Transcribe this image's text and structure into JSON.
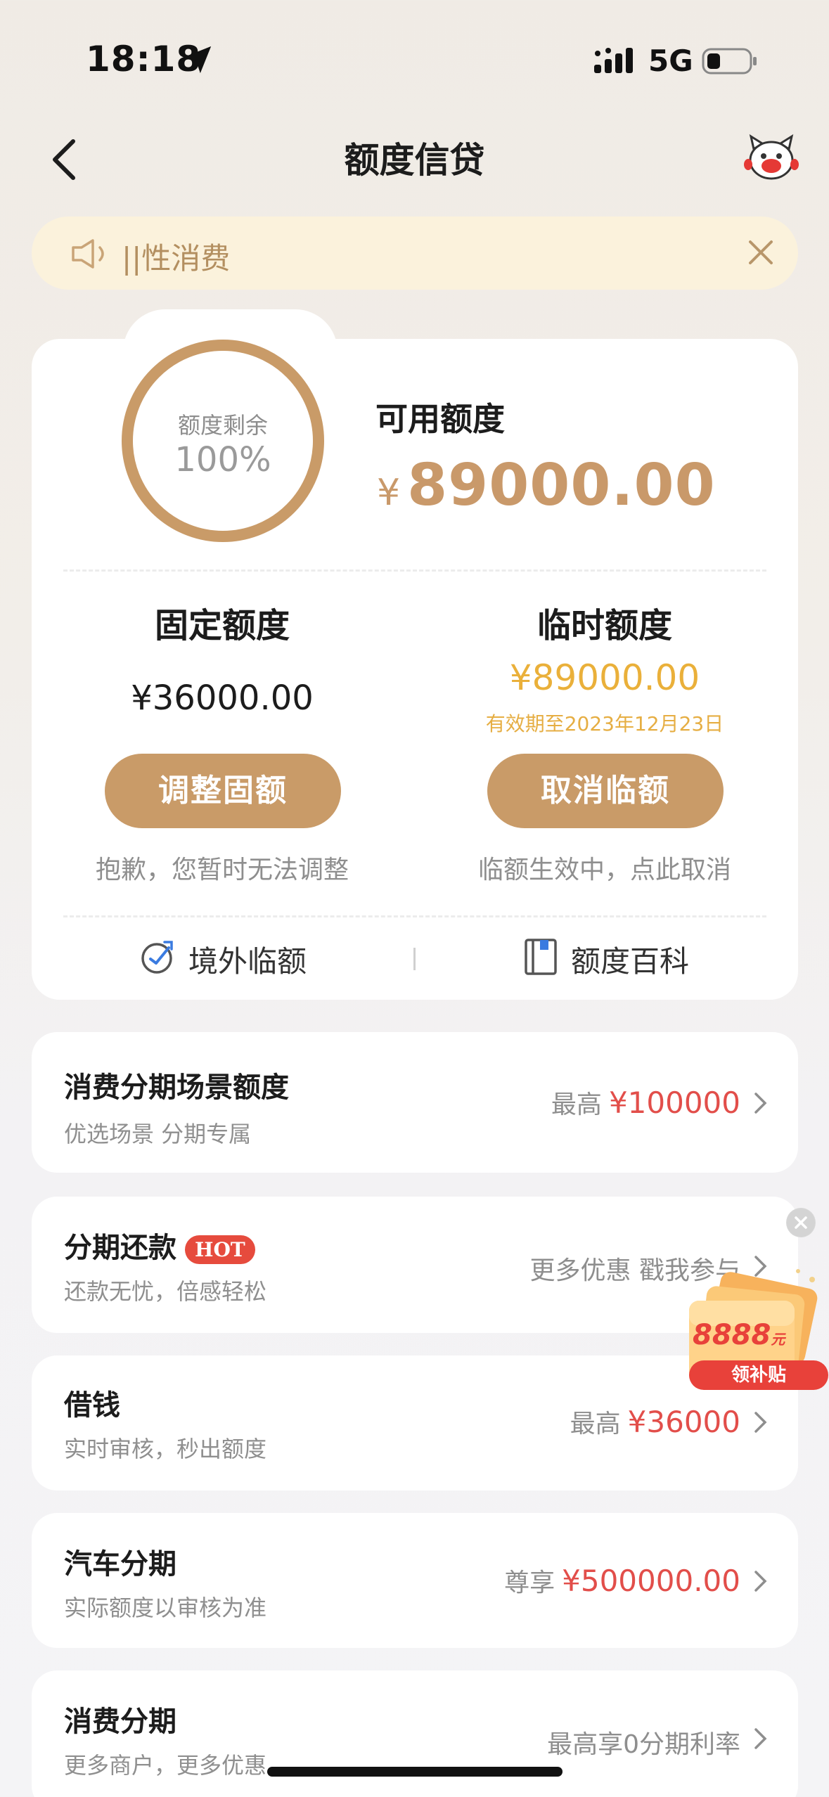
{
  "status_bar": {
    "time": "18:18",
    "network": "5G"
  },
  "nav": {
    "title": "额度信贷"
  },
  "notice": {
    "text": "||性消费"
  },
  "credit": {
    "ring_label": "额度剩余",
    "ring_percent": "100%",
    "remaining_fraction": 1.0,
    "available_label": "可用额度",
    "available_currency": "¥",
    "available_amount": "89000.00"
  },
  "fixed": {
    "title": "固定额度",
    "amount": "¥36000.00",
    "button": "调整固额",
    "note": "抱歉，您暂时无法调整"
  },
  "temporary": {
    "title": "临时额度",
    "amount": "¥89000.00",
    "expiry": "有效期至2023年12月23日",
    "button": "取消临额",
    "note": "临额生效中，点此取消"
  },
  "links": {
    "overseas": "境外临额",
    "encyclopedia": "额度百科"
  },
  "cards": [
    {
      "title": "消费分期场景额度",
      "subtitle": "优选场景 分期专属",
      "right_prefix": "最高",
      "right_value": "¥100000"
    },
    {
      "title": "分期还款",
      "badge": "HOT",
      "subtitle": "还款无忧，倍感轻松",
      "right_text": "更多优惠 戳我参与"
    },
    {
      "title": "借钱",
      "subtitle": "实时审核，秒出额度",
      "right_prefix": "最高",
      "right_value": "¥36000"
    },
    {
      "title": "汽车分期",
      "subtitle": "实际额度以审核为准",
      "right_prefix": "尊享",
      "right_value": "¥500000.00"
    },
    {
      "title": "消费分期",
      "subtitle": "更多商户，更多优惠",
      "right_text": "最高享0分期利率"
    }
  ],
  "promo": {
    "amount": "8888",
    "unit": "元",
    "label": "领补贴"
  },
  "colors": {
    "gold": "#c99b68",
    "red": "#e24e4a",
    "amber": "#eab03a",
    "notice_bg": "#fbf2dc"
  },
  "icons": [
    "location-arrow-icon",
    "signal-icon",
    "battery-icon",
    "back-icon",
    "mascot-icon",
    "speaker-icon",
    "close-icon",
    "plane-globe-icon",
    "book-icon",
    "chevron-right-icon"
  ]
}
